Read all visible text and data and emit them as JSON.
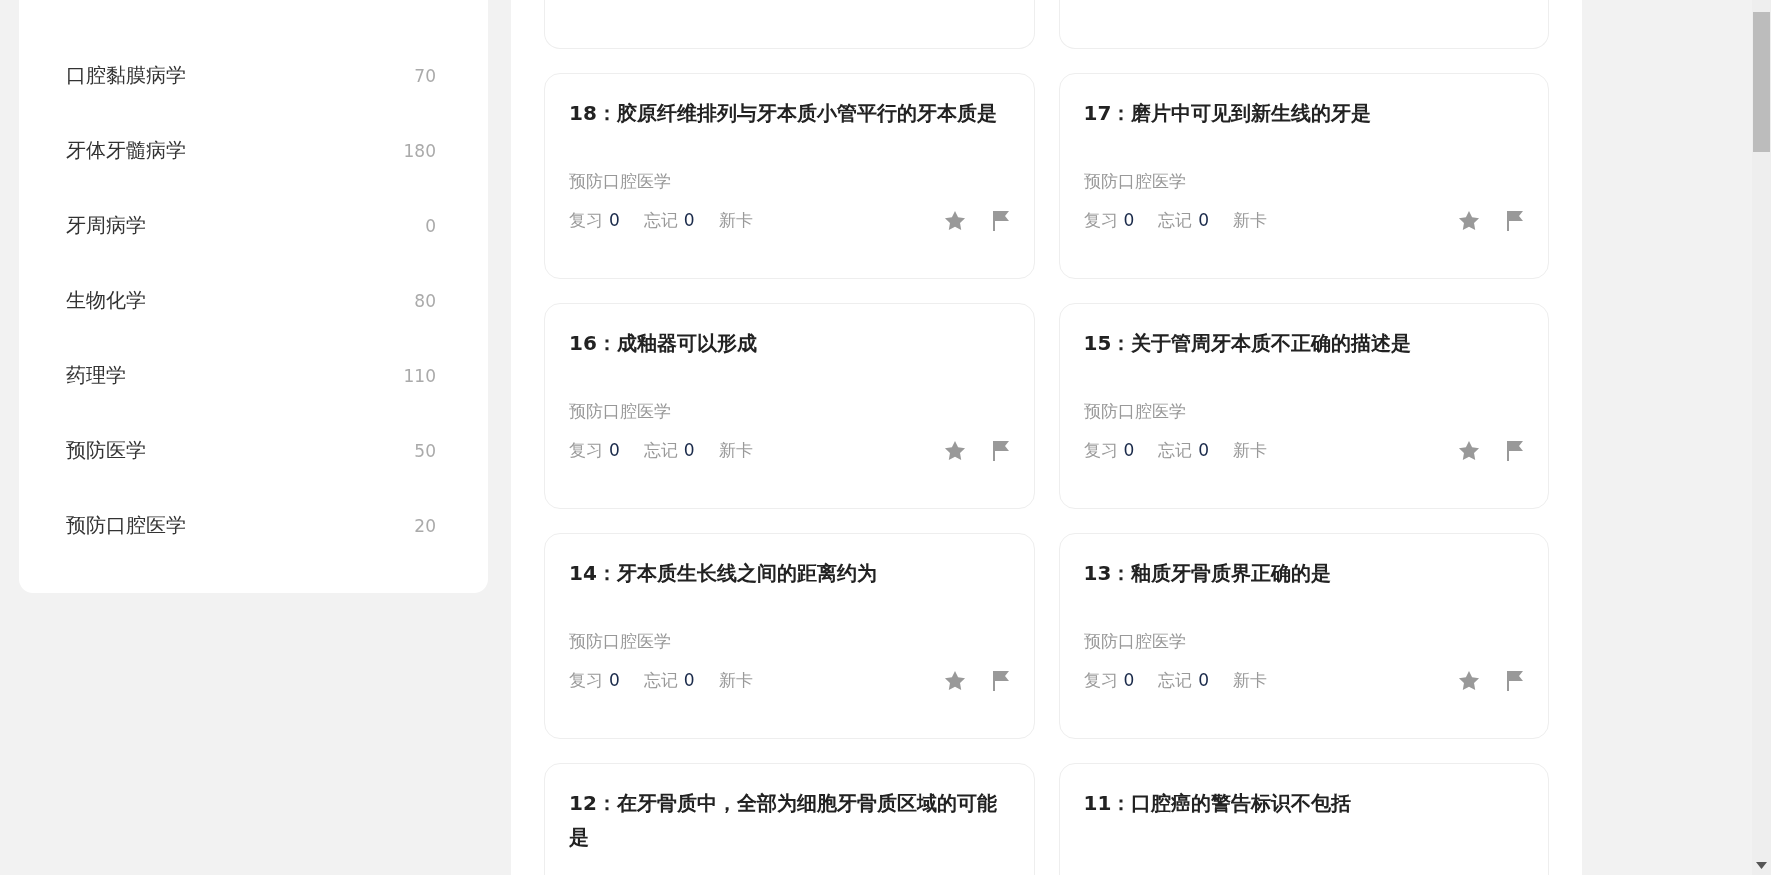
{
  "sidebar": {
    "items": [
      {
        "label": "口腔黏膜病学",
        "count": "70"
      },
      {
        "label": "牙体牙髓病学",
        "count": "180"
      },
      {
        "label": "牙周病学",
        "count": "0"
      },
      {
        "label": "生物化学",
        "count": "80"
      },
      {
        "label": "药理学",
        "count": "110"
      },
      {
        "label": "预防医学",
        "count": "50"
      },
      {
        "label": "预防口腔医学",
        "count": "20"
      }
    ]
  },
  "cards": [
    {
      "title": "18：胶原纤维排列与牙本质小管平行的牙本质是",
      "subject": "预防口腔医学",
      "review_label": "复习",
      "review_count": "0",
      "forget_label": "忘记",
      "forget_count": "0",
      "status": "新卡"
    },
    {
      "title": "17：磨片中可见到新生线的牙是",
      "subject": "预防口腔医学",
      "review_label": "复习",
      "review_count": "0",
      "forget_label": "忘记",
      "forget_count": "0",
      "status": "新卡"
    },
    {
      "title": "16：成釉器可以形成",
      "subject": "预防口腔医学",
      "review_label": "复习",
      "review_count": "0",
      "forget_label": "忘记",
      "forget_count": "0",
      "status": "新卡"
    },
    {
      "title": "15：关于管周牙本质不正确的描述是",
      "subject": "预防口腔医学",
      "review_label": "复习",
      "review_count": "0",
      "forget_label": "忘记",
      "forget_count": "0",
      "status": "新卡"
    },
    {
      "title": "14：牙本质生长线之间的距离约为",
      "subject": "预防口腔医学",
      "review_label": "复习",
      "review_count": "0",
      "forget_label": "忘记",
      "forget_count": "0",
      "status": "新卡"
    },
    {
      "title": "13：釉质牙骨质界正确的是",
      "subject": "预防口腔医学",
      "review_label": "复习",
      "review_count": "0",
      "forget_label": "忘记",
      "forget_count": "0",
      "status": "新卡"
    }
  ],
  "partial_cards": [
    {
      "title": "12：在牙骨质中，全部为细胞牙骨质区域的可能是"
    },
    {
      "title": "11：口腔癌的警告标识不包括"
    }
  ]
}
